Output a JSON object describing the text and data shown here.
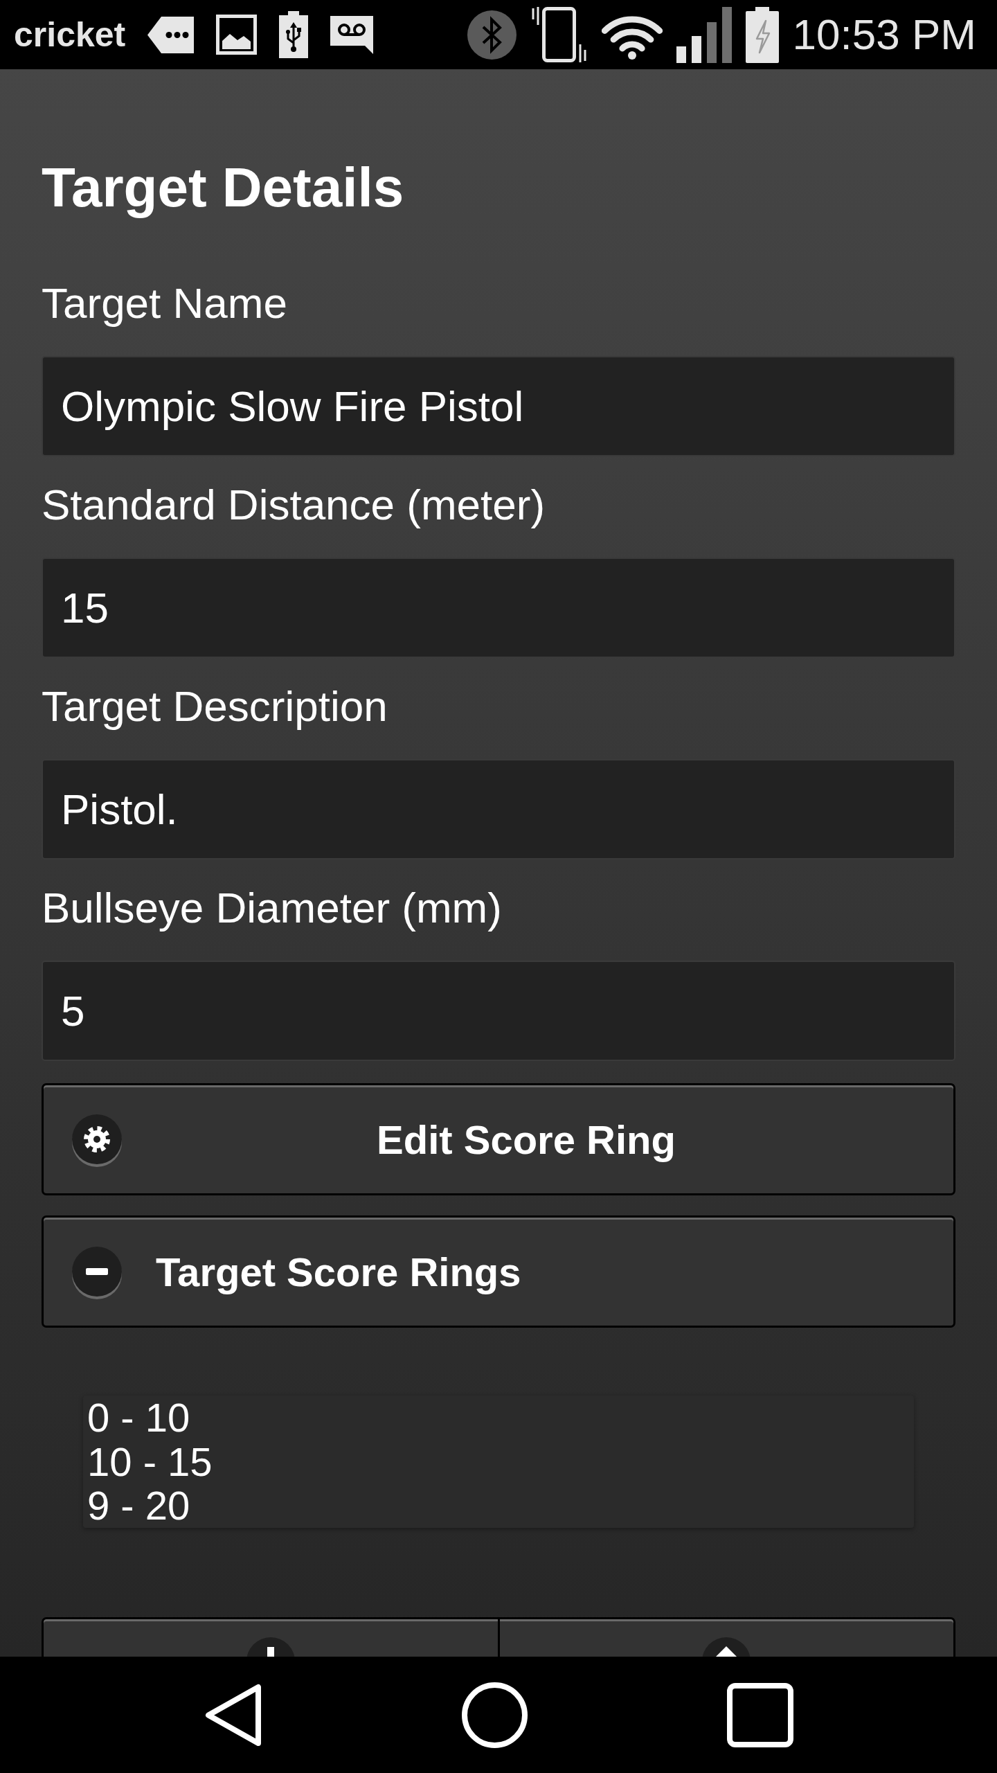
{
  "status_bar": {
    "carrier": "cricket",
    "time": "10:53 PM"
  },
  "page": {
    "title": "Target Details"
  },
  "fields": [
    {
      "label": "Target Name",
      "value": "Olympic Slow Fire Pistol"
    },
    {
      "label": "Standard Distance (meter)",
      "value": "15"
    },
    {
      "label": "Target Description",
      "value": "Pistol."
    },
    {
      "label": "Bullseye Diameter (mm)",
      "value": "5"
    }
  ],
  "edit_button": {
    "label": "Edit Score Ring"
  },
  "score_rings": {
    "title": "Target Score Rings",
    "expanded": true,
    "items": [
      "0 - 10",
      "10 - 15",
      "9 - 20"
    ]
  }
}
